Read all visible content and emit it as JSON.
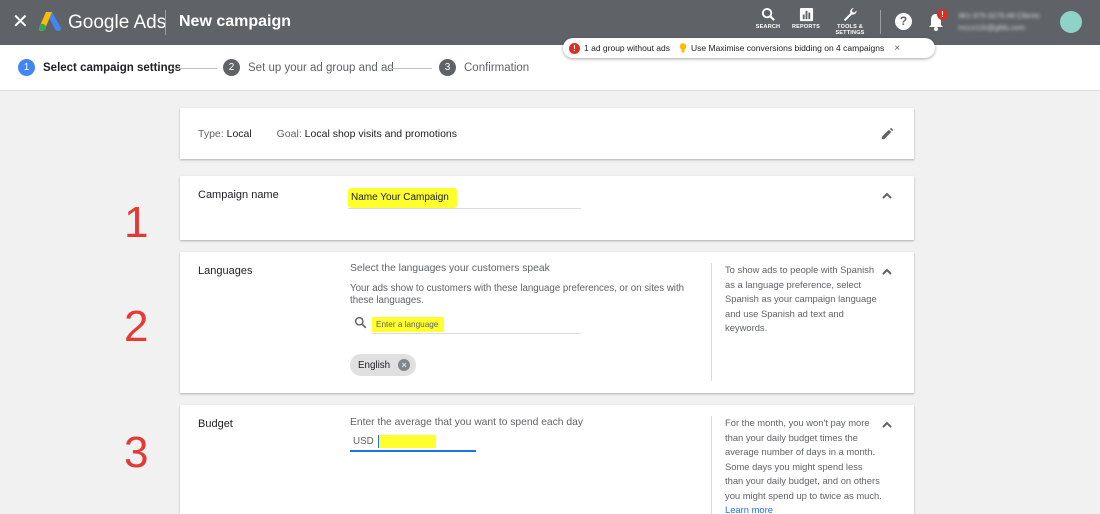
{
  "header": {
    "brand": "Google Ads",
    "title": "New campaign",
    "tools": [
      {
        "label": "SEARCH",
        "icon": "search-icon"
      },
      {
        "label": "REPORTS",
        "icon": "reports-icon"
      },
      {
        "label": "TOOLS & SETTINGS",
        "icon": "wrench-icon"
      }
    ],
    "help_glyph": "?",
    "notifications_badge": "!",
    "account_line1": "361-375-3276 All Clients",
    "account_line2": "mccx11k@gfds.com"
  },
  "stepper": {
    "steps": [
      {
        "number": "1",
        "label": "Select campaign settings",
        "active": true
      },
      {
        "number": "2",
        "label": "Set up your ad group and ad",
        "active": false
      },
      {
        "number": "3",
        "label": "Confirmation",
        "active": false
      }
    ]
  },
  "notice": {
    "error_text": "1 ad group without ads",
    "tip_text": "Use Maximise conversions bidding on 4 campaigns",
    "close": "×"
  },
  "summary": {
    "type_label": "Type:",
    "type_value": "Local",
    "goal_label": "Goal:",
    "goal_value": "Local shop visits and promotions"
  },
  "campaign_name": {
    "title": "Campaign name",
    "value": "Name Your Campaign"
  },
  "languages": {
    "title": "Languages",
    "heading": "Select the languages your customers speak",
    "description": "Your ads show to customers with these language preferences, or on sites with these languages.",
    "search_placeholder": "Enter a language",
    "chip": "English",
    "help": "To show ads to people with Spanish as a language preference, select Spanish as your campaign language and use Spanish ad text and keywords."
  },
  "budget": {
    "title": "Budget",
    "heading": "Enter the average that you want to spend each day",
    "currency": "USD",
    "help": "For the month, you won't pay more than your daily budget times the average number of days in a month. Some days you might spend less than your daily budget, and on others you might spend up to twice as much.",
    "learn_more": "Learn more"
  },
  "annotations": [
    "1",
    "2",
    "3"
  ],
  "colors": {
    "topbar": "#5f6368",
    "accent": "#1a73e8",
    "highlight": "#ffff2e",
    "annotation": "#e53935",
    "error": "#d93025"
  }
}
